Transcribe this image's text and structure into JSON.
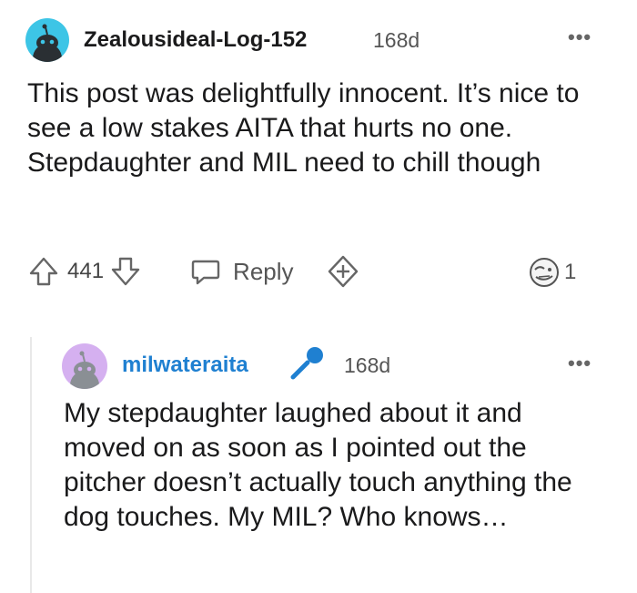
{
  "comment": {
    "username": "Zealousideal-Log-152",
    "age": "168d",
    "body": "This post was delightfully innocent. It’s nice to see a low stakes AITA that hurts no one. Stepdaughter and MIL need to chill though",
    "votes": "441",
    "reply_label": "Reply",
    "award_count": "1",
    "avatar_color": "#3dc5e6"
  },
  "reply": {
    "username": "milwateraita",
    "age": "168d",
    "body": "My stepdaughter laughed about it and moved on as soon as I pointed out the pitcher doesn’t actually touch anything the dog touches. My MIL? Who knows…",
    "username_color": "#1f80d1",
    "avatar_color": "#d5b0f0"
  },
  "icons": {
    "upvote": "arrow-up-outline",
    "downvote": "arrow-down-outline",
    "reply": "speech-bubble",
    "award": "plus-badge",
    "mic": "microphone",
    "more": "three-dots"
  }
}
